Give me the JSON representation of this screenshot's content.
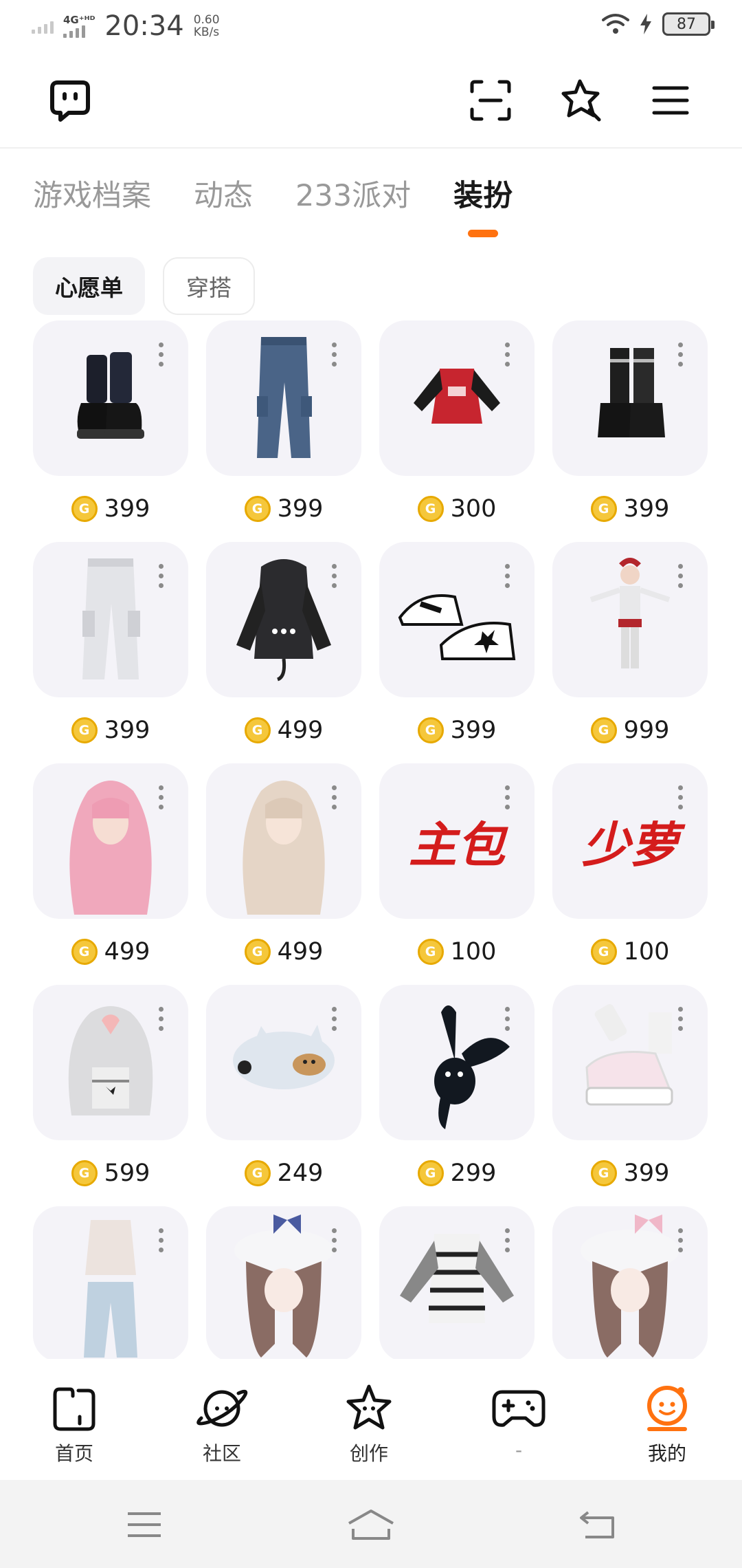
{
  "status_bar": {
    "network": "4G⁺ᴴᴰ",
    "time": "20:34",
    "speed_value": "0.60",
    "speed_unit": "KB/s",
    "battery": "87"
  },
  "tabs": [
    {
      "label": "游戏档案"
    },
    {
      "label": "动态"
    },
    {
      "label": "233派对"
    },
    {
      "label": "装扮"
    }
  ],
  "chips": [
    {
      "label": "心愿单"
    },
    {
      "label": "穿搭"
    }
  ],
  "items": [
    {
      "price": "399",
      "icon": "boots"
    },
    {
      "price": "399",
      "icon": "jeans"
    },
    {
      "price": "300",
      "icon": "red-sweater"
    },
    {
      "price": "399",
      "icon": "platform-boots"
    },
    {
      "price": "399",
      "icon": "white-cargo-pants"
    },
    {
      "price": "499",
      "icon": "black-hoodie"
    },
    {
      "price": "399",
      "icon": "sneakers"
    },
    {
      "price": "999",
      "icon": "full-outfit"
    },
    {
      "price": "499",
      "icon": "pink-hair"
    },
    {
      "price": "499",
      "icon": "blonde-hair"
    },
    {
      "price": "100",
      "icon": "text-sticker",
      "sticker_text": "主包"
    },
    {
      "price": "100",
      "icon": "text-sticker",
      "sticker_text": "少萝"
    },
    {
      "price": "599",
      "icon": "silver-hair"
    },
    {
      "price": "249",
      "icon": "hat"
    },
    {
      "price": "299",
      "icon": "bunny-ears"
    },
    {
      "price": "399",
      "icon": "pink-sneakers"
    },
    {
      "price": "",
      "icon": "tube-top-outfit"
    },
    {
      "price": "",
      "icon": "braided-hair-blue-bow"
    },
    {
      "price": "",
      "icon": "striped-sweater"
    },
    {
      "price": "",
      "icon": "braided-hair-pink-bow"
    }
  ],
  "bottom_nav": [
    {
      "label": "首页"
    },
    {
      "label": "社区"
    },
    {
      "label": "创作"
    },
    {
      "label": "-"
    },
    {
      "label": "我的"
    }
  ],
  "colors": {
    "accent": "#ff7210",
    "coin": "#f5c73b",
    "card_bg": "#f4f3f8"
  }
}
